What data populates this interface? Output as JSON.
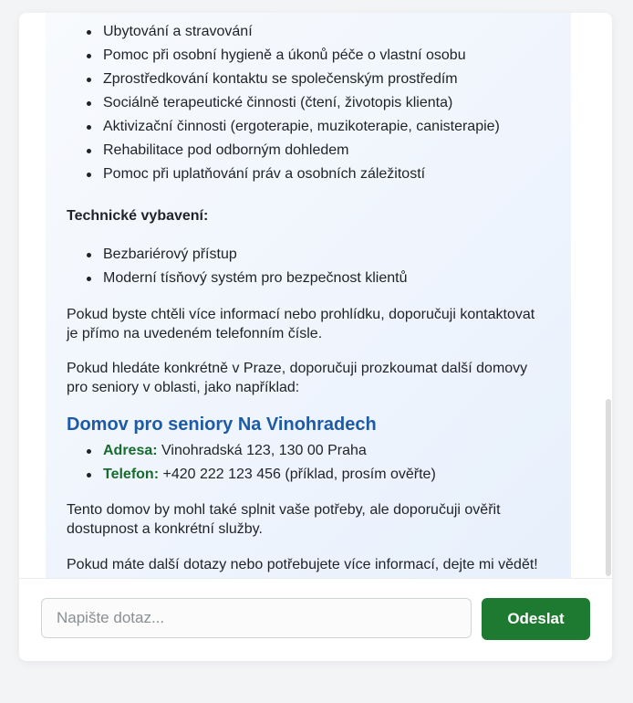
{
  "services": {
    "items": [
      "Ubytování a stravování",
      "Pomoc při osobní hygieně a úkonů péče o vlastní osobu",
      "Zprostředkování kontaktu se společenským prostředím",
      "Sociálně terapeutické činnosti (čtení, životopis klienta)",
      "Aktivizační činnosti (ergoterapie, muzikoterapie, canisterapie)",
      "Rehabilitace pod odborným dohledem",
      "Pomoc při uplatňování práv a osobních záležitostí"
    ]
  },
  "technical": {
    "heading": "Technické vybavení:",
    "items": [
      "Bezbariérový přístup",
      "Moderní tísňový systém pro bezpečnost klientů"
    ]
  },
  "paragraphs": {
    "more_info": "Pokud byste chtěli více informací nebo prohlídku, doporučuji kontaktovat je přímo na uvedeném telefonním čísle.",
    "prague": "Pokud hledáte konkrétně v Praze, doporučuji prozkoumat další domovy pro seniory v oblasti, jako například:",
    "fit": "Tento domov by mohl také splnit vaše potřeby, ale doporučuji ověřit dostupnost a konkrétní služby.",
    "closing": "Pokud máte další dotazy nebo potřebujete více informací, dejte mi vědět!"
  },
  "home": {
    "title": "Domov pro seniory Na Vinohradech",
    "address_label": "Adresa:",
    "address_value": " Vinohradská 123, 130 00 Praha",
    "phone_label": "Telefon:",
    "phone_value": " +420 222 123 456 (příklad, prosím ověřte)"
  },
  "input": {
    "placeholder": "Napište dotaz...",
    "value": ""
  },
  "send_button": {
    "label": "Odeslat"
  },
  "colors": {
    "accent_green": "#1e7a30",
    "title_blue": "#1f5aa6"
  }
}
